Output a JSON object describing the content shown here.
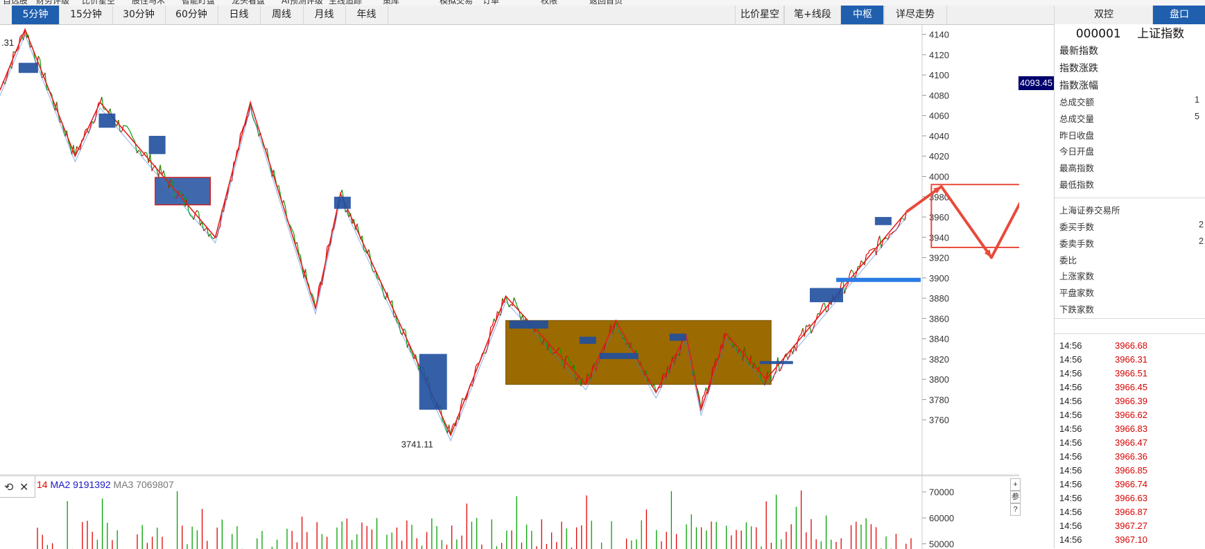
{
  "top_menu": [
    "自选股",
    "财务评级",
    "比价星空",
    "股性马术",
    "智能盯盘",
    "龙头看盘",
    "AI预测评级",
    "主线追踪",
    "策库",
    "模拟交易",
    "订单",
    "权限",
    "返回首页"
  ],
  "timeframe_tabs": [
    {
      "label": "5分钟",
      "active": true
    },
    {
      "label": "15分钟",
      "active": false
    },
    {
      "label": "30分钟",
      "active": false
    },
    {
      "label": "60分钟",
      "active": false
    },
    {
      "label": "日线",
      "active": false
    },
    {
      "label": "周线",
      "active": false
    },
    {
      "label": "月线",
      "active": false
    },
    {
      "label": "年线",
      "active": false
    }
  ],
  "tool_tabs": [
    {
      "label": "比价星空",
      "active": false
    },
    {
      "label": "笔+线段",
      "active": false
    },
    {
      "label": "中枢",
      "active": true
    },
    {
      "label": "详尽走势",
      "active": false
    }
  ],
  "side_tabs": [
    {
      "label": "双控",
      "active": false
    },
    {
      "label": "盘口",
      "active": true
    }
  ],
  "current_price_tag": "4093.45",
  "side_panel": {
    "code": "000001",
    "name": "上证指数",
    "main_rows": [
      "最新指数",
      "指数涨跌",
      "指数涨幅"
    ],
    "info_rows": [
      {
        "label": "总成交额",
        "value": "1"
      },
      {
        "label": "总成交量",
        "value": "5"
      },
      {
        "label": "昨日收盘",
        "value": ""
      },
      {
        "label": "今日开盘",
        "value": ""
      },
      {
        "label": "最高指数",
        "value": ""
      },
      {
        "label": "最低指数",
        "value": ""
      }
    ],
    "exchange": "上海证券交易所",
    "breadth_rows": [
      {
        "label": "委买手数",
        "value": "2"
      },
      {
        "label": "委卖手数",
        "value": "2"
      },
      {
        "label": "委比",
        "value": ""
      },
      {
        "label": "上涨家数",
        "value": ""
      },
      {
        "label": "平盘家数",
        "value": ""
      },
      {
        "label": "下跌家数",
        "value": ""
      }
    ],
    "ticks": [
      {
        "time": "14:56",
        "price": "3966.68"
      },
      {
        "time": "14:56",
        "price": "3966.31"
      },
      {
        "time": "14:56",
        "price": "3966.51"
      },
      {
        "time": "14:56",
        "price": "3966.45"
      },
      {
        "time": "14:56",
        "price": "3966.39"
      },
      {
        "time": "14:56",
        "price": "3966.62"
      },
      {
        "time": "14:56",
        "price": "3966.83"
      },
      {
        "time": "14:56",
        "price": "3966.47"
      },
      {
        "time": "14:56",
        "price": "3966.36"
      },
      {
        "time": "14:56",
        "price": "3966.85"
      },
      {
        "time": "14:56",
        "price": "3966.74"
      },
      {
        "time": "14:56",
        "price": "3966.63"
      },
      {
        "time": "14:56",
        "price": "3966.87"
      },
      {
        "time": "14:56",
        "price": "3967.27"
      },
      {
        "time": "14:56",
        "price": "3967.10"
      }
    ]
  },
  "volume_legend": {
    "ma1": "14",
    "ma2": "MA2 9191392",
    "ma3": "MA3 7069807"
  },
  "volume_buttons": [
    "+",
    "参",
    "?"
  ],
  "colors": {
    "up": "#e00000",
    "down": "#00a000",
    "stroke": "#e02020",
    "box_blue": "#1f4f9f",
    "zhongshu_fill": "#9b6a00",
    "accent": "#1f5fae"
  },
  "chart_data": {
    "type": "line",
    "y_ticks": [
      4140,
      4120,
      4100,
      4080,
      4060,
      4040,
      4020,
      4000,
      3980,
      3960,
      3940,
      3920,
      3900,
      3880,
      3860,
      3840,
      3820,
      3800,
      3780,
      3760
    ],
    "ylim": [
      3740,
      4150
    ],
    "x_index_range": [
      0,
      180
    ],
    "bi_points": [
      {
        "i": 0,
        "p": 4085
      },
      {
        "i": 5,
        "p": 4145
      },
      {
        "i": 15,
        "p": 4020
      },
      {
        "i": 20,
        "p": 4073
      },
      {
        "i": 43,
        "p": 3940
      },
      {
        "i": 50,
        "p": 4073
      },
      {
        "i": 63,
        "p": 3870
      },
      {
        "i": 68,
        "p": 3983
      },
      {
        "i": 90,
        "p": 3745
      },
      {
        "i": 101,
        "p": 3882
      },
      {
        "i": 117,
        "p": 3795
      },
      {
        "i": 123,
        "p": 3858
      },
      {
        "i": 131,
        "p": 3787
      },
      {
        "i": 137,
        "p": 3844
      },
      {
        "i": 140,
        "p": 3770
      },
      {
        "i": 145,
        "p": 3845
      },
      {
        "i": 153,
        "p": 3800
      },
      {
        "i": 181,
        "p": 3965
      }
    ],
    "projection_points": [
      {
        "i": 188,
        "p": 3990
      },
      {
        "i": 198,
        "p": 3920
      },
      {
        "i": 207,
        "p": 4005
      },
      {
        "i": 214,
        "p": 3935
      },
      {
        "i": 220,
        "p": 3975
      }
    ],
    "annotations": [
      {
        "text": ".31",
        "i": 0,
        "p": 4137
      },
      {
        "text": "3741.11",
        "i": 84,
        "p": 3741
      }
    ],
    "zhongshu": [
      {
        "i0": 101,
        "i1": 154,
        "low": 3795,
        "high": 3858,
        "style": "fill"
      },
      {
        "i0": 31,
        "i1": 42,
        "low": 3972,
        "high": 3999,
        "style": "blue"
      }
    ],
    "volume_ticks": [
      70000,
      60000,
      50000
    ]
  }
}
